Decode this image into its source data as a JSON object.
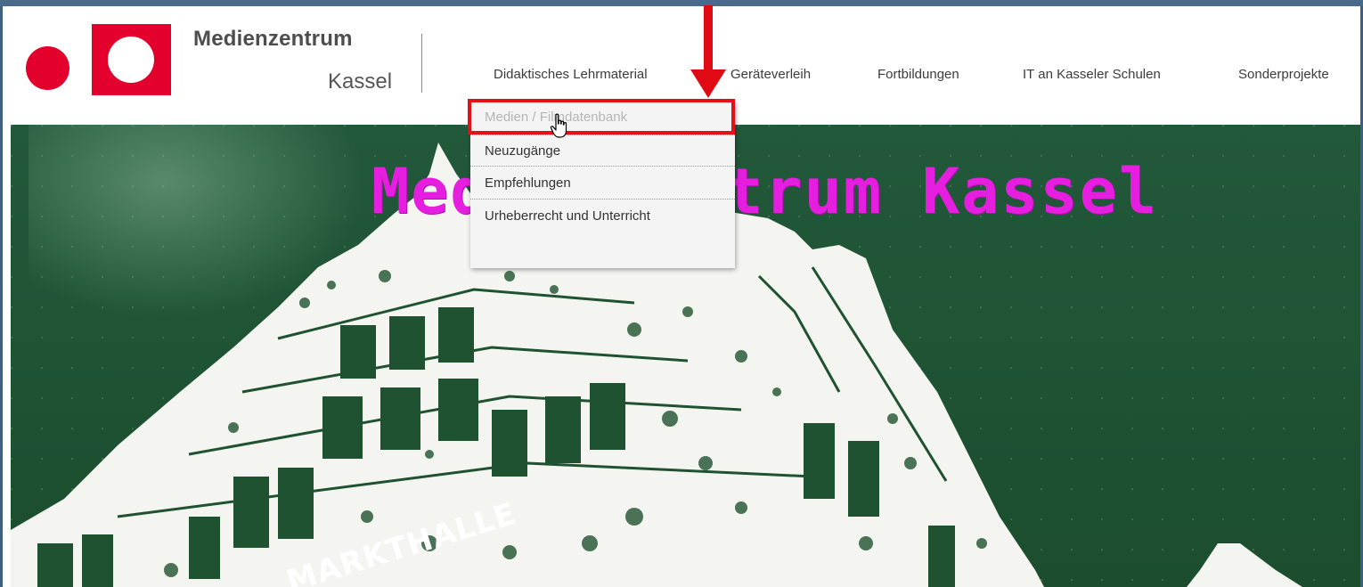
{
  "brand": {
    "name": "Medienzentrum",
    "city": "Kassel"
  },
  "nav": {
    "items": [
      {
        "label": "Didaktisches Lehrmaterial"
      },
      {
        "label": "Geräteverleih"
      },
      {
        "label": "Fortbildungen"
      },
      {
        "label": "IT an Kasseler Schulen"
      },
      {
        "label": "Sonderprojekte"
      }
    ]
  },
  "dropdown": {
    "items": [
      {
        "label": "Medien / Filmdatenbank"
      },
      {
        "label": "Neuzugänge"
      },
      {
        "label": "Empfehlungen"
      },
      {
        "label": "Urheberrecht und Unterricht"
      }
    ]
  },
  "hero": {
    "title": "Medienzentrum Kassel",
    "building_sign": "MARKTHALLE"
  },
  "colors": {
    "brand_red": "#e3002c",
    "annotation_red": "#e00a14",
    "hero_green": "#1f5230",
    "hero_title": "#e61ee0"
  },
  "icons": {
    "cursor": "hand-pointer-icon",
    "annotation": "down-arrow-icon"
  }
}
